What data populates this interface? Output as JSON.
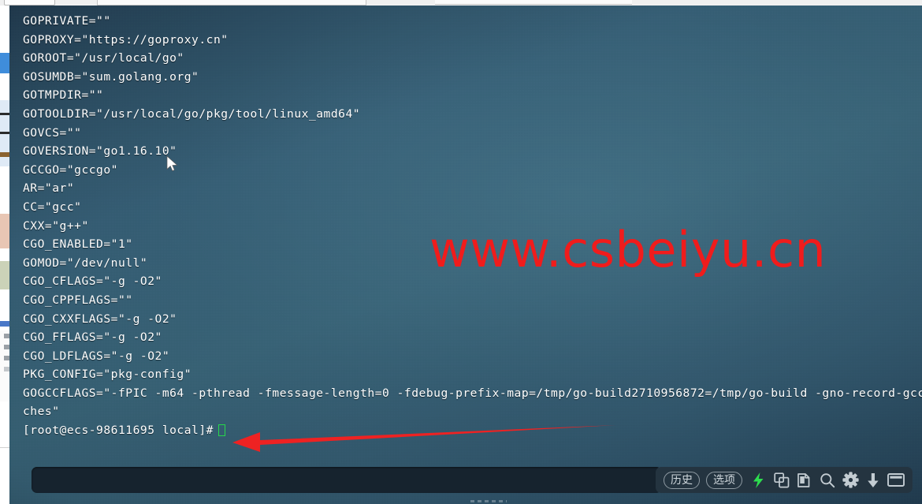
{
  "terminal": {
    "lines": [
      "GOPRIVATE=\"\"",
      "GOPROXY=\"https://goproxy.cn\"",
      "GOROOT=\"/usr/local/go\"",
      "GOSUMDB=\"sum.golang.org\"",
      "GOTMPDIR=\"\"",
      "GOTOOLDIR=\"/usr/local/go/pkg/tool/linux_amd64\"",
      "GOVCS=\"\"",
      "GOVERSION=\"go1.16.10\"",
      "GCCGO=\"gccgo\"",
      "AR=\"ar\"",
      "CC=\"gcc\"",
      "CXX=\"g++\"",
      "CGO_ENABLED=\"1\"",
      "GOMOD=\"/dev/null\"",
      "CGO_CFLAGS=\"-g -O2\"",
      "CGO_CPPFLAGS=\"\"",
      "CGO_CXXFLAGS=\"-g -O2\"",
      "CGO_FFLAGS=\"-g -O2\"",
      "CGO_LDFLAGS=\"-g -O2\"",
      "PKG_CONFIG=\"pkg-config\"",
      "GOGCCFLAGS=\"-fPIC -m64 -pthread -fmessage-length=0 -fdebug-prefix-map=/tmp/go-build2710956872=/tmp/go-build -gno-record-gcc-swit",
      "ches\""
    ],
    "prompt": "[root@ecs-98611695 local]#",
    "cursor_color": "#27d84a",
    "text_color": "#ffffff",
    "background_color": "#37627 5"
  },
  "watermark": {
    "text": "www.csbeiyu.cn",
    "color": "#f01c1c"
  },
  "annotation": {
    "arrow_color": "#ee2222",
    "arrow_direction": "left"
  },
  "bottom_bar": {
    "command_input": {
      "value": "",
      "placeholder": ""
    },
    "buttons": [
      {
        "label": "历史",
        "name": "history-button"
      },
      {
        "label": "选项",
        "name": "options-button"
      }
    ],
    "icons": [
      {
        "name": "lightning-bolt-icon",
        "color": "#2ddd4e"
      },
      {
        "name": "copy-icon",
        "color": "#c3ccd2"
      },
      {
        "name": "paste-icon",
        "color": "#c3ccd2"
      },
      {
        "name": "search-icon",
        "color": "#c3ccd2"
      },
      {
        "name": "gear-icon",
        "color": "#c3ccd2"
      },
      {
        "name": "download-icon",
        "color": "#c3ccd2"
      },
      {
        "name": "window-icon",
        "color": "#c3ccd2"
      }
    ]
  }
}
